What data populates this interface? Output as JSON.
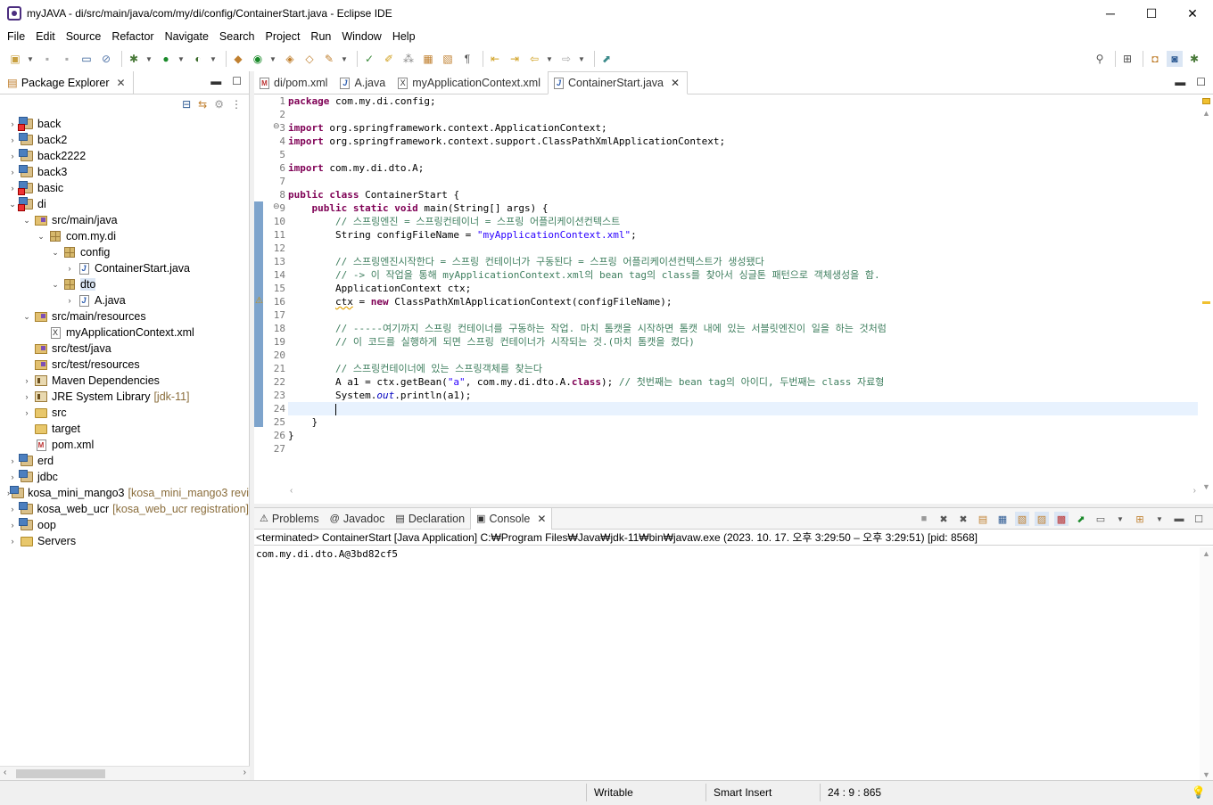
{
  "window": {
    "title": "myJAVA - di/src/main/java/com/my/di/config/ContainerStart.java - Eclipse IDE",
    "minimize": "─",
    "maximize": "☐",
    "close": "✕"
  },
  "menu": [
    "File",
    "Edit",
    "Source",
    "Refactor",
    "Navigate",
    "Search",
    "Project",
    "Run",
    "Window",
    "Help"
  ],
  "package_explorer": {
    "tab_label": "Package Explorer",
    "tree": [
      {
        "label": "back",
        "depth": 0,
        "icon": "project-error-icon",
        "toggle": "›"
      },
      {
        "label": "back2",
        "depth": 0,
        "icon": "project-icon",
        "toggle": "›"
      },
      {
        "label": "back2222",
        "depth": 0,
        "icon": "project-icon",
        "toggle": "›"
      },
      {
        "label": "back3",
        "depth": 0,
        "icon": "project-icon",
        "toggle": "›"
      },
      {
        "label": "basic",
        "depth": 0,
        "icon": "project-error-icon",
        "toggle": "›"
      },
      {
        "label": "di",
        "depth": 0,
        "icon": "project-error-icon",
        "toggle": "⌄"
      },
      {
        "label": "src/main/java",
        "depth": 1,
        "icon": "source-folder-icon",
        "toggle": "⌄"
      },
      {
        "label": "com.my.di",
        "depth": 2,
        "icon": "package-icon",
        "toggle": "⌄"
      },
      {
        "label": "config",
        "depth": 3,
        "icon": "package-icon",
        "toggle": "⌄"
      },
      {
        "label": "ContainerStart.java",
        "depth": 4,
        "icon": "java-file-icon",
        "toggle": "›"
      },
      {
        "label": "dto",
        "depth": 3,
        "icon": "package-icon",
        "toggle": "⌄",
        "selected": true
      },
      {
        "label": "A.java",
        "depth": 4,
        "icon": "java-file-icon",
        "toggle": "›"
      },
      {
        "label": "src/main/resources",
        "depth": 1,
        "icon": "source-folder-icon",
        "toggle": "⌄"
      },
      {
        "label": "myApplicationContext.xml",
        "depth": 2,
        "icon": "xml-file-icon",
        "toggle": ""
      },
      {
        "label": "src/test/java",
        "depth": 1,
        "icon": "source-folder-icon",
        "toggle": ""
      },
      {
        "label": "src/test/resources",
        "depth": 1,
        "icon": "source-folder-icon",
        "toggle": ""
      },
      {
        "label": "Maven Dependencies",
        "depth": 1,
        "icon": "library-icon",
        "toggle": "›"
      },
      {
        "label": "JRE System Library",
        "deco": "[jdk-11]",
        "depth": 1,
        "icon": "library-icon",
        "toggle": "›"
      },
      {
        "label": "src",
        "depth": 1,
        "icon": "folder-icon",
        "toggle": "›"
      },
      {
        "label": "target",
        "depth": 1,
        "icon": "folder-icon",
        "toggle": ""
      },
      {
        "label": "pom.xml",
        "depth": 1,
        "icon": "pom-file-icon",
        "toggle": ""
      },
      {
        "label": "erd",
        "depth": 0,
        "icon": "project-icon",
        "toggle": "›"
      },
      {
        "label": "jdbc",
        "depth": 0,
        "icon": "project-icon",
        "toggle": "›"
      },
      {
        "label": "kosa_mini_mango3",
        "deco": "[kosa_mini_mango3 revi",
        "depth": 0,
        "icon": "project-icon",
        "toggle": "›"
      },
      {
        "label": "kosa_web_ucr",
        "deco": "[kosa_web_ucr registration]",
        "depth": 0,
        "icon": "project-icon",
        "toggle": "›"
      },
      {
        "label": "oop",
        "depth": 0,
        "icon": "project-icon",
        "toggle": "›"
      },
      {
        "label": "Servers",
        "depth": 0,
        "icon": "folder-icon",
        "toggle": "›"
      }
    ]
  },
  "editor": {
    "tabs": [
      {
        "label": "di/pom.xml",
        "icon": "pom-file-icon",
        "active": false
      },
      {
        "label": "A.java",
        "icon": "java-file-icon",
        "active": false
      },
      {
        "label": "myApplicationContext.xml",
        "icon": "xml-file-icon",
        "active": false
      },
      {
        "label": "ContainerStart.java",
        "icon": "java-file-icon",
        "active": true
      }
    ],
    "current_line": 24,
    "lines": [
      [
        [
          "kw",
          "package"
        ],
        [
          "t",
          " com.my.di.config;"
        ]
      ],
      [],
      [
        [
          "kw",
          "import"
        ],
        [
          "t",
          " org.springframework.context.ApplicationContext;"
        ]
      ],
      [
        [
          "kw",
          "import"
        ],
        [
          "t",
          " org.springframework.context.support.ClassPathXmlApplicationContext;"
        ]
      ],
      [],
      [
        [
          "kw",
          "import"
        ],
        [
          "t",
          " com.my.di.dto.A;"
        ]
      ],
      [],
      [
        [
          "kw",
          "public"
        ],
        [
          "t",
          " "
        ],
        [
          "kw",
          "class"
        ],
        [
          "t",
          " ContainerStart {"
        ]
      ],
      [
        [
          "t",
          "    "
        ],
        [
          "kw",
          "public"
        ],
        [
          "t",
          " "
        ],
        [
          "kw",
          "static"
        ],
        [
          "t",
          " "
        ],
        [
          "kw",
          "void"
        ],
        [
          "t",
          " main(String[] args) {"
        ]
      ],
      [
        [
          "t",
          "        "
        ],
        [
          "cmt",
          "// 스프링엔진 = 스프링컨테이너 = 스프링 어플리케이션컨텍스트"
        ]
      ],
      [
        [
          "t",
          "        String configFileName = "
        ],
        [
          "str",
          "\"myApplicationContext.xml\""
        ],
        [
          "t",
          ";"
        ]
      ],
      [],
      [
        [
          "t",
          "        "
        ],
        [
          "cmt",
          "// 스프링엔진시작한다 = 스프링 컨테이너가 구동된다 = 스프링 어플리케이션컨텍스트가 생성됐다"
        ]
      ],
      [
        [
          "t",
          "        "
        ],
        [
          "cmt",
          "// -> 이 작업을 통해 myApplicationContext.xml의 bean tag의 class를 찾아서 싱글톤 패턴으로 객체생성을 함."
        ]
      ],
      [
        [
          "t",
          "        ApplicationContext ctx;"
        ]
      ],
      [
        [
          "t",
          "        "
        ],
        [
          "warn",
          "ctx"
        ],
        [
          "t",
          " = "
        ],
        [
          "kw",
          "new"
        ],
        [
          "t",
          " ClassPathXmlApplicationContext(configFileName);"
        ]
      ],
      [],
      [
        [
          "t",
          "        "
        ],
        [
          "cmt",
          "// -----여기까지 스프링 컨테이너를 구동하는 작업. 마치 톰캣을 시작하면 톰캣 내에 있는 서블릿엔진이 일을 하는 것처럼"
        ]
      ],
      [
        [
          "t",
          "        "
        ],
        [
          "cmt",
          "// 이 코드를 실행하게 되면 스프링 컨테이너가 시작되는 것.(마치 톰캣을 켰다)"
        ]
      ],
      [],
      [
        [
          "t",
          "        "
        ],
        [
          "cmt",
          "// 스프링컨테이너에 있는 스프링객체를 찾는다"
        ]
      ],
      [
        [
          "t",
          "        A a1 = ctx.getBean("
        ],
        [
          "str",
          "\"a\""
        ],
        [
          "t",
          ", com.my.di.dto.A."
        ],
        [
          "kw",
          "class"
        ],
        [
          "t",
          "); "
        ],
        [
          "cmt",
          "// 첫번째는 bean tag의 아이디, 두번째는 class 자료형"
        ]
      ],
      [
        [
          "t",
          "        System."
        ],
        [
          "fld",
          "out"
        ],
        [
          "t",
          ".println(a1);"
        ]
      ],
      [
        [
          "t",
          "        "
        ],
        [
          "caret",
          ""
        ]
      ],
      [
        [
          "t",
          "    }"
        ]
      ],
      [
        [
          "t",
          "}"
        ]
      ],
      []
    ]
  },
  "console": {
    "tabs": [
      {
        "label": "Problems",
        "icon": "problems-icon",
        "glyph": "⚠"
      },
      {
        "label": "Javadoc",
        "icon": "javadoc-icon",
        "glyph": "@"
      },
      {
        "label": "Declaration",
        "icon": "declaration-icon",
        "glyph": "▤"
      },
      {
        "label": "Console",
        "icon": "console-icon",
        "glyph": "▣",
        "active": true
      }
    ],
    "status": "<terminated> ContainerStart [Java Application] C:₩Program Files₩Java₩jdk-11₩bin₩javaw.exe  (2023. 10. 17. 오후 3:29:50 – 오후 3:29:51) [pid: 8568]",
    "output": "com.my.di.dto.A@3bd82cf5"
  },
  "statusbar": {
    "writable": "Writable",
    "insert_mode": "Smart Insert",
    "position": "24 : 9 : 865"
  }
}
